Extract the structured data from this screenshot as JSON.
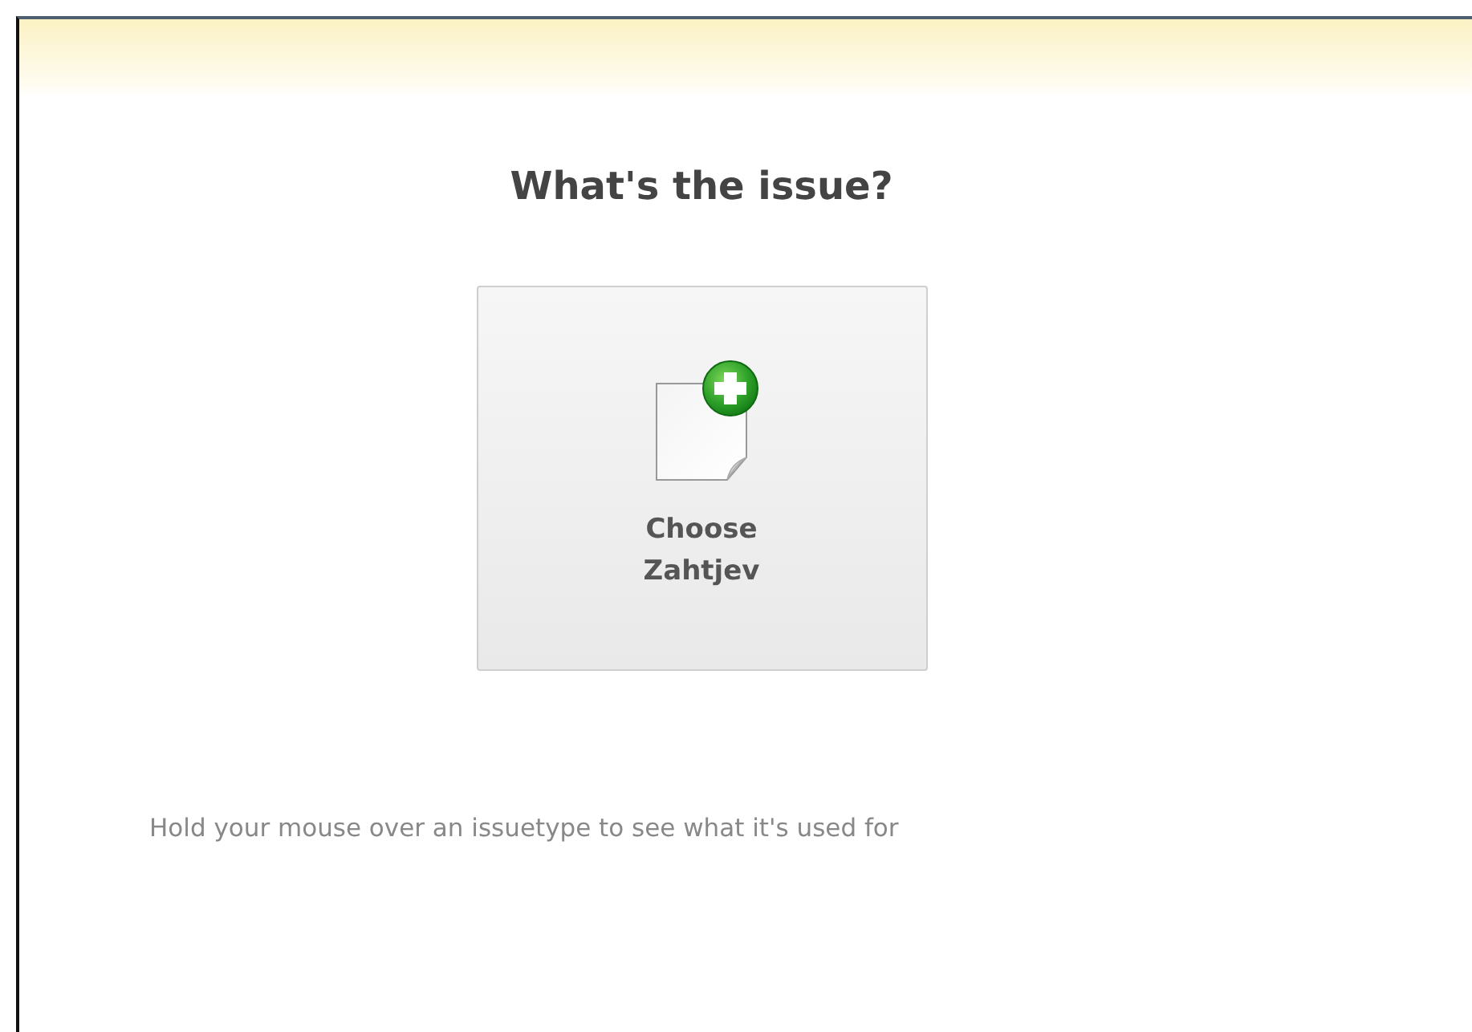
{
  "heading": "What's the issue?",
  "issue_types": [
    {
      "label": "Choose Zahtjev"
    }
  ],
  "hint": "Hold your mouse over an issuetype to see what it's used for"
}
